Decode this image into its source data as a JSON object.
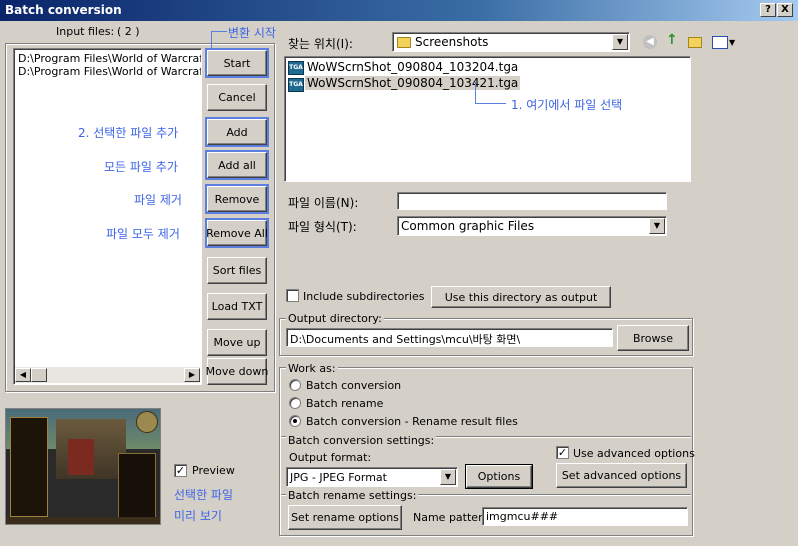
{
  "window": {
    "title": "Batch conversion",
    "help_label": "?",
    "close_label": "X"
  },
  "input": {
    "label": "Input files:",
    "count": "( 2 )",
    "files": [
      "D:\\Program Files\\World of Warcraft\\Sc",
      "D:\\Program Files\\World of Warcraft\\Sc"
    ]
  },
  "buttons": {
    "start": "Start",
    "cancel": "Cancel",
    "add": "Add",
    "add_all": "Add all",
    "remove": "Remove",
    "remove_all": "Remove All",
    "sort_files": "Sort files",
    "load_txt": "Load TXT",
    "move_up": "Move up",
    "move_down": "Move down"
  },
  "annotations": {
    "start": "변환 시작",
    "add": "2. 선택한 파일 추가",
    "add_all": "모든 파일 추가",
    "remove": "파일 제거",
    "remove_all": "파일 모두 제거",
    "select": "1. 여기에서 파일 선택",
    "preview_line1": "선택한 파일",
    "preview_line2": "미리 보기"
  },
  "browser": {
    "look_in_label": "찾는 위치(I):",
    "look_in_value": "Screenshots",
    "files": [
      {
        "name": "WoWScrnShot_090804_103204.tga",
        "icon": "tga-file-icon",
        "selected": false
      },
      {
        "name": "WoWScrnShot_090804_103421.tga",
        "icon": "tga-file-icon",
        "selected": true
      }
    ],
    "filename_label": "파일 이름(N):",
    "filename_value": "",
    "filetype_label": "파일 형식(T):",
    "filetype_value": "Common graphic Files"
  },
  "preview": {
    "checkbox_label": "Preview",
    "checked": true
  },
  "subdirs": {
    "label": "Include subdirectories",
    "checked": false
  },
  "use_dir_button": "Use this directory as output",
  "output": {
    "group_label": "Output directory:",
    "path": "D:\\Documents and Settings\\mcu\\바탕 화면\\",
    "browse": "Browse"
  },
  "work_as": {
    "group_label": "Work as:",
    "options": [
      {
        "label": "Batch conversion",
        "selected": false
      },
      {
        "label": "Batch rename",
        "selected": false
      },
      {
        "label": "Batch conversion - Rename result files",
        "selected": true
      }
    ]
  },
  "conversion": {
    "group_label": "Batch conversion settings:",
    "format_label": "Output format:",
    "format_value": "JPG - JPEG Format",
    "options_button": "Options",
    "advanced_label": "Use advanced options",
    "advanced_checked": true,
    "set_advanced_button": "Set advanced options"
  },
  "rename": {
    "group_label": "Batch rename settings:",
    "set_rename_button": "Set rename options",
    "pattern_label": "Name pattern:",
    "pattern_value": "imgmcu###"
  },
  "colors": {
    "annotation": "#3c64e6",
    "face": "#d4d0c8",
    "title_start": "#0a246a"
  }
}
